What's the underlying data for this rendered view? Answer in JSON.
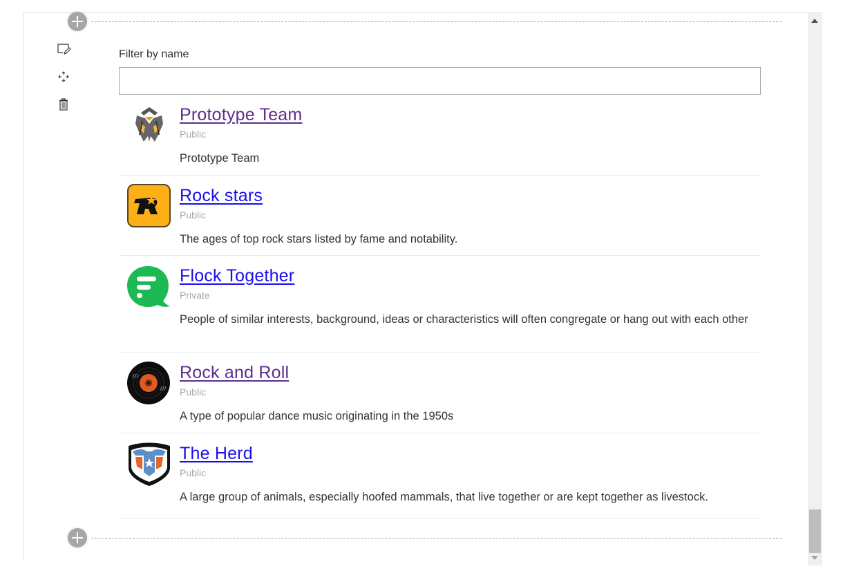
{
  "toolbar": {
    "icons": [
      "edit-icon",
      "move-icon",
      "delete-icon"
    ]
  },
  "filter": {
    "label": "Filter by name",
    "value": "",
    "placeholder": ""
  },
  "groups": [
    {
      "title": "Prototype Team",
      "privacy": "Public",
      "description": "Prototype Team",
      "visited": true,
      "logo": "prototype-team-logo"
    },
    {
      "title": "Rock stars",
      "privacy": "Public",
      "description": "The ages of top rock stars listed by fame and notability.",
      "visited": false,
      "logo": "rock-stars-logo"
    },
    {
      "title": "Flock Together",
      "privacy": "Private",
      "description": "People of similar interests, background, ideas or characteristics will often congregate or hang out with each other",
      "visited": false,
      "logo": "flock-together-logo"
    },
    {
      "title": "Rock and Roll",
      "privacy": "Public",
      "description": "A type of popular dance music originating in the 1950s",
      "visited": true,
      "logo": "rock-and-roll-logo"
    },
    {
      "title": "The Herd",
      "privacy": "Public",
      "description": "A large group of animals, especially hoofed mammals, that live together or are kept together as livestock.",
      "visited": false,
      "logo": "the-herd-logo"
    }
  ],
  "colors": {
    "visited_link": "#5c2d91",
    "unvisited_link": "#1a0dee",
    "privacy_text": "#a6a6a6",
    "add_button": "#a6a6a6"
  },
  "scrollbar": {
    "position_fraction": 0.92
  }
}
